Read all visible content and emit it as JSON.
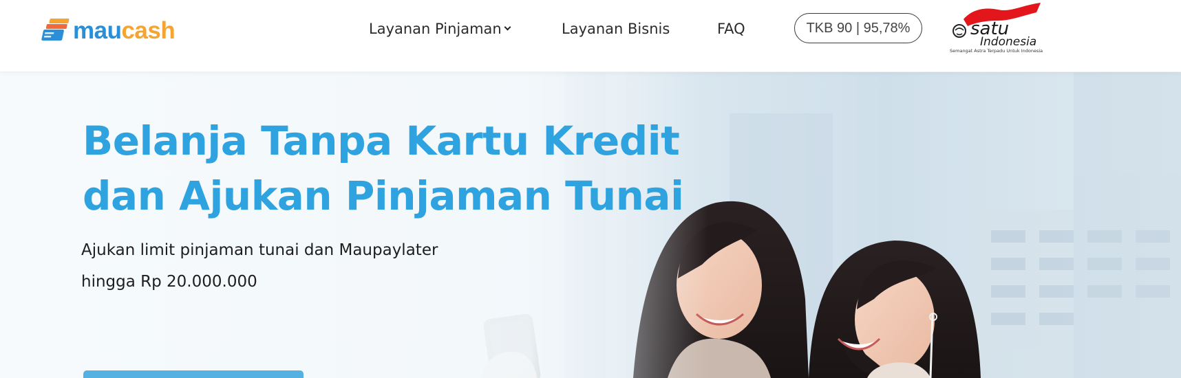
{
  "brand": {
    "name_part1": "mau",
    "name_part2": "cash",
    "primary_color": "#2a8fd6",
    "accent_color": "#f6a431"
  },
  "nav": {
    "items": [
      {
        "label": "Layanan Pinjaman",
        "has_dropdown": true
      },
      {
        "label": "Layanan Bisnis"
      },
      {
        "label": "FAQ"
      }
    ],
    "tkb_badge": "TKB 90 | 95,78%"
  },
  "partner_logo": {
    "name": "satu Indonesia",
    "tagline": "Semangat Astra Terpadu Untuk Indonesia",
    "icon": "satu-indonesia-logo"
  },
  "hero": {
    "title_line1": "Belanja Tanpa Kartu Kredit",
    "title_line2": "dan Ajukan Pinjaman Tunai",
    "subtitle_line1": "Ajukan limit pinjaman tunai dan Maupaylater",
    "subtitle_line2": "hingga Rp 20.000.000",
    "title_color": "#2ea3e0",
    "cta_color": "#55b1e2",
    "image": "two-women-smiling-at-phone"
  }
}
